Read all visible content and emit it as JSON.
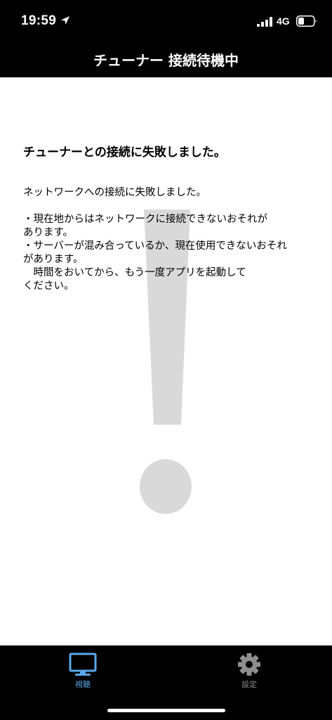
{
  "status_bar": {
    "time": "19:59",
    "network": "4G"
  },
  "header": {
    "title": "チューナー 接続待機中"
  },
  "error": {
    "title": "チューナーとの接続に失敗しました。",
    "message": "ネットワークへの接続に失敗しました。\n\n・現在地からはネットワークに接続できないおそれが\nあります。\n・サーバーが混み合っているか、現在使用できないおそれ\nがあります。\n　時間をおいてから、もう一度アプリを起動して\nください。"
  },
  "tabs": [
    {
      "label": "視聴",
      "icon": "tv-icon",
      "active": true,
      "color": "#5aa9ea"
    },
    {
      "label": "設定",
      "icon": "gear-icon",
      "active": false,
      "color": "#8e8e8e"
    }
  ],
  "colors": {
    "bar_background": "#000000",
    "content_background": "#ffffff",
    "exclamation_mark": "#d9d9d9",
    "active_tab": "#5aa9ea",
    "inactive_tab": "#8e8e8e"
  }
}
